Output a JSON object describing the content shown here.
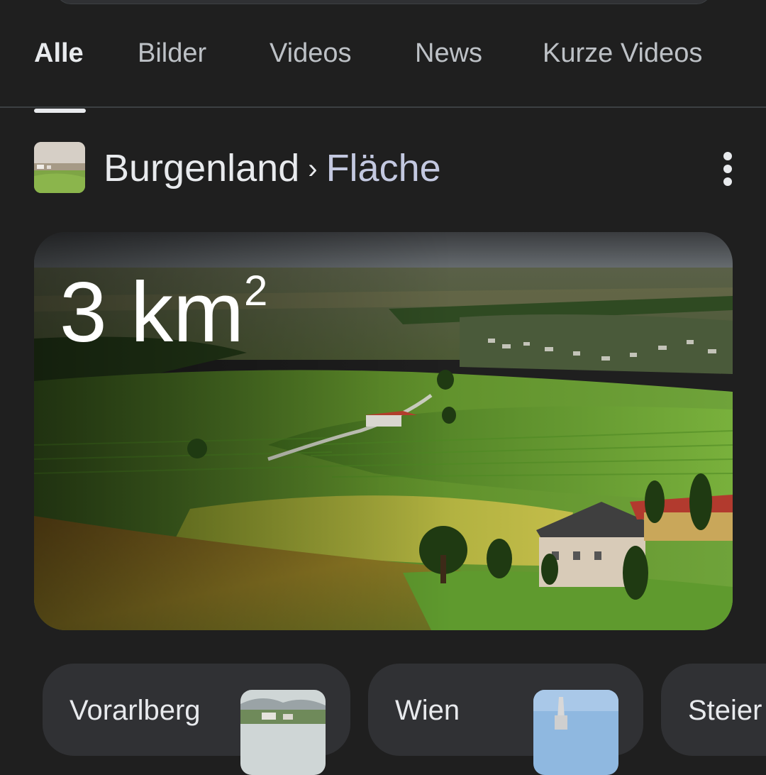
{
  "tabs": [
    {
      "label": "Alle",
      "active": true
    },
    {
      "label": "Bilder",
      "active": false
    },
    {
      "label": "Videos",
      "active": false
    },
    {
      "label": "News",
      "active": false
    },
    {
      "label": "Kurze Videos",
      "active": false
    }
  ],
  "header": {
    "entity": "Burgenland",
    "separator": "›",
    "attribute": "Fläche"
  },
  "result": {
    "number": "3 km",
    "superscript": "2"
  },
  "related": [
    {
      "label": "Vorarlberg"
    },
    {
      "label": "Wien"
    },
    {
      "label": "Steier"
    }
  ],
  "icons": {
    "more": "more-vert-icon"
  },
  "colors": {
    "background": "#1f1f1f",
    "chip": "#303134",
    "text": "#e8eaed",
    "attribute_text": "#c3c8e0"
  }
}
